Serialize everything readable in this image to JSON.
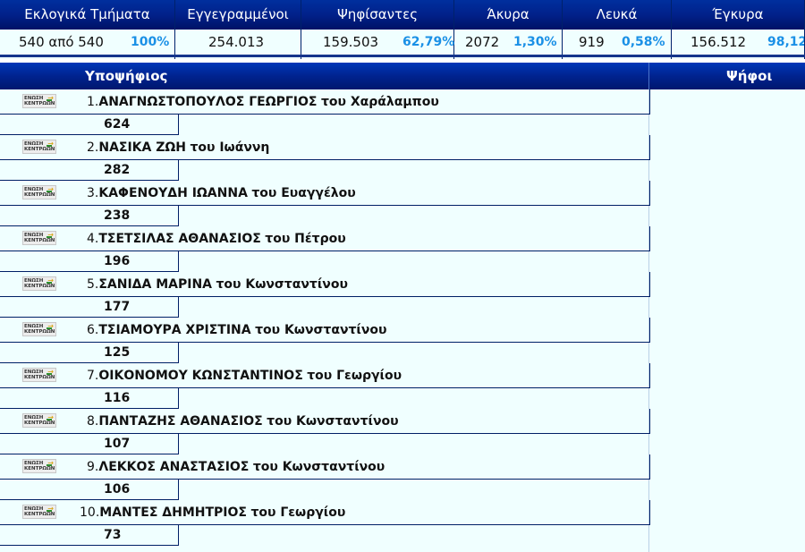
{
  "stats": {
    "columns": [
      {
        "header": "Εκλογικά Τμήματα",
        "value": "540 από 540",
        "pct": "100%"
      },
      {
        "header": "Εγγεγραμμένοι",
        "value": "254.013",
        "pct": ""
      },
      {
        "header": "Ψηφίσαντες",
        "value": "159.503",
        "pct": "62,79%"
      },
      {
        "header": "Άκυρα",
        "value": "2072",
        "pct": "1,30%"
      },
      {
        "header": "Λευκά",
        "value": "919",
        "pct": "0,58%"
      },
      {
        "header": "Έγκυρα",
        "value": "156.512",
        "pct": "98,12"
      }
    ]
  },
  "candidates": {
    "header_name": "Υποψήφιος",
    "header_votes": "Ψήφοι",
    "party_logo_text": "ΕΝΩΣΗ\nΚΕΝΤΡΩΩΝ",
    "party_logo_icon": "party-logo-icon",
    "list": [
      {
        "rank": "1.",
        "surname": "ΑΝΑΓΝΩΣΤΟΠΟΥΛΟΣ ΓΕΩΡΓΙΟΣ",
        "patronymic": "του Χαράλαμπου",
        "votes": "624"
      },
      {
        "rank": "2.",
        "surname": "ΝΑΣΙΚΑ ΖΩΗ",
        "patronymic": "του Ιωάννη",
        "votes": "282"
      },
      {
        "rank": "3.",
        "surname": "ΚΑΦΕΝΟΥΔΗ ΙΩΑΝΝΑ",
        "patronymic": "του Ευαγγέλου",
        "votes": "238"
      },
      {
        "rank": "4.",
        "surname": "ΤΣΕΤΣΙΛΑΣ ΑΘΑΝΑΣΙΟΣ",
        "patronymic": "του Πέτρου",
        "votes": "196"
      },
      {
        "rank": "5.",
        "surname": "ΣΑΝΙΔΑ ΜΑΡΙΝΑ",
        "patronymic": "του Κωνσταντίνου",
        "votes": "177"
      },
      {
        "rank": "6.",
        "surname": "ΤΣΙΑΜΟΥΡΑ ΧΡΙΣΤΙΝΑ",
        "patronymic": "του Κωνσταντίνου",
        "votes": "125"
      },
      {
        "rank": "7.",
        "surname": "ΟΙΚΟΝΟΜΟΥ ΚΩΝΣΤΑΝΤΙΝΟΣ",
        "patronymic": "του Γεωργίου",
        "votes": "116"
      },
      {
        "rank": "8.",
        "surname": "ΠΑΝΤΑΖΗΣ ΑΘΑΝΑΣΙΟΣ",
        "patronymic": "του Κωνσταντίνου",
        "votes": "107"
      },
      {
        "rank": "9.",
        "surname": "ΛΕΚΚΟΣ ΑΝΑΣΤΑΣΙΟΣ",
        "patronymic": "του Κωνσταντίνου",
        "votes": "106"
      },
      {
        "rank": "10.",
        "surname": "ΜΑΝΤΕΣ ΔΗΜΗΤΡΙΟΣ",
        "patronymic": "του Γεωργίου",
        "votes": "73"
      }
    ]
  },
  "colors": {
    "header_bg": "#00238f",
    "row_bg": "#f0ffff",
    "percent": "#1a90e6",
    "border": "#001f66"
  }
}
